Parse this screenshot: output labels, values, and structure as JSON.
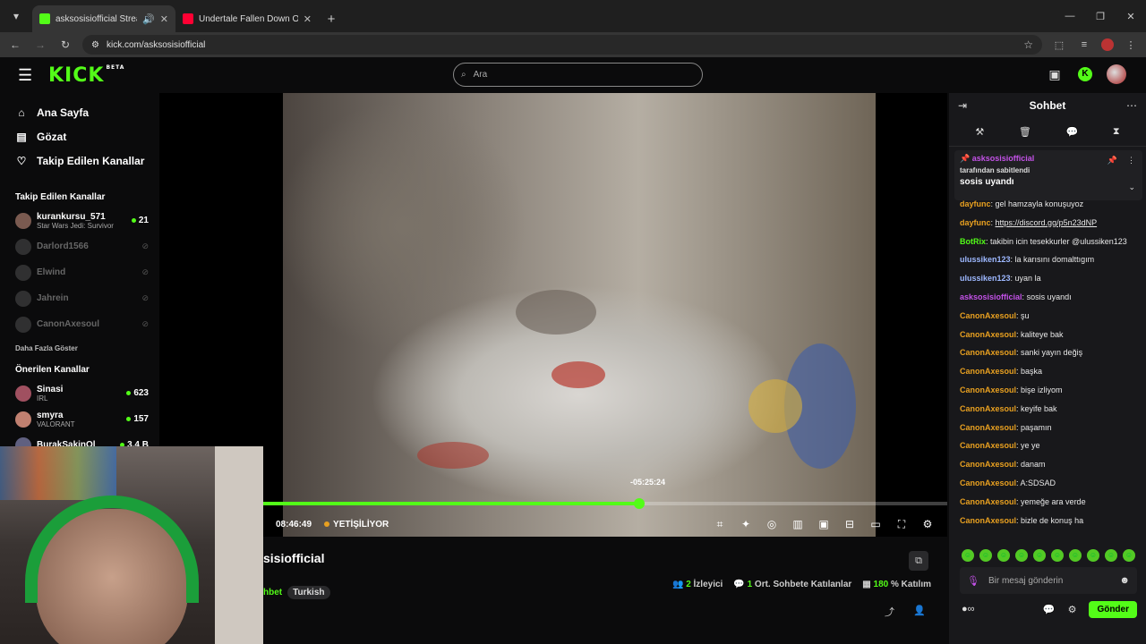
{
  "browser": {
    "tabs": [
      {
        "title": "asksosisiofficial Stream - W",
        "favicon_color": "#53fc18",
        "active": true
      },
      {
        "title": "Undertale Fallen Down OST #",
        "favicon_color": "#ff0033",
        "active": false
      }
    ],
    "url": "kick.com/asksosisiofficial"
  },
  "header": {
    "logo": "KICK",
    "logo_badge": "BETA",
    "search_placeholder": "Ara"
  },
  "sidebar": {
    "nav": [
      {
        "label": "Ana Sayfa",
        "icon": "home-icon"
      },
      {
        "label": "Gözat",
        "icon": "browse-icon"
      },
      {
        "label": "Takip Edilen Kanallar",
        "icon": "heart-icon"
      }
    ],
    "followed_title": "Takip Edilen Kanallar",
    "followed": [
      {
        "name": "kurankursu_571",
        "category": "Star Wars Jedi: Survivor",
        "viewers": "21",
        "live": true
      },
      {
        "name": "Darlord1566",
        "live": false
      },
      {
        "name": "Elwind",
        "live": false
      },
      {
        "name": "Jahrein",
        "live": false
      },
      {
        "name": "CanonAxesoul",
        "live": false
      }
    ],
    "show_more": "Daha Fazla Göster",
    "recommended_title": "Önerilen Kanallar",
    "recommended": [
      {
        "name": "Sinasi",
        "category": "IRL",
        "viewers": "623"
      },
      {
        "name": "smyra",
        "category": "VALORANT",
        "viewers": "157"
      },
      {
        "name": "BurakSakinOl",
        "category": "",
        "viewers": "3.4 B"
      }
    ]
  },
  "player": {
    "elapsed": "08:46:49",
    "live_label": "YETİŞİLİYOR",
    "hover_time": "-05:25:24",
    "progress": 0.55
  },
  "stream": {
    "title_visible": "sisiofficial",
    "category_visible": "hbet",
    "language_tag": "Turkish",
    "viewers_count": "2",
    "viewers_label": "İzleyici",
    "chatters_count": "1",
    "chatters_label": "Ort. Sohbete Katılanlar",
    "participation_count": "180",
    "participation_label": "% Katılım"
  },
  "chat": {
    "title": "Sohbet",
    "pinned": {
      "user": "asksosisiofficial",
      "by": "tarafından sabitlendi",
      "message": "sosis uyandı"
    },
    "messages": [
      {
        "user": "dayfunc",
        "color": "#e8a020",
        "text": "gel hamzayla konuşuyoz"
      },
      {
        "user": "dayfunc",
        "color": "#e8a020",
        "text": "https://discord.gg/p5n23dNP",
        "link": true
      },
      {
        "user": "BotRix",
        "color": "#53fc18",
        "text": "takibin icin tesekkurler @ulussiken123"
      },
      {
        "user": "ulussiken123",
        "color": "#9db8ff",
        "text": "la karısını domalttıgım"
      },
      {
        "user": "ulussiken123",
        "color": "#9db8ff",
        "text": "uyan la"
      },
      {
        "user": "asksosisiofficial",
        "color": "#c452e8",
        "text": "sosis uyandı"
      },
      {
        "user": "CanonAxesoul",
        "color": "#e8a020",
        "text": "şu"
      },
      {
        "user": "CanonAxesoul",
        "color": "#e8a020",
        "text": "kaliteye bak"
      },
      {
        "user": "CanonAxesoul",
        "color": "#e8a020",
        "text": "sanki yayın değiş"
      },
      {
        "user": "CanonAxesoul",
        "color": "#e8a020",
        "text": "başka"
      },
      {
        "user": "CanonAxesoul",
        "color": "#e8a020",
        "text": "bişe izliyom"
      },
      {
        "user": "CanonAxesoul",
        "color": "#e8a020",
        "text": "keyife bak"
      },
      {
        "user": "CanonAxesoul",
        "color": "#e8a020",
        "text": "paşamın"
      },
      {
        "user": "CanonAxesoul",
        "color": "#e8a020",
        "text": "ye ye"
      },
      {
        "user": "CanonAxesoul",
        "color": "#e8a020",
        "text": "danam"
      },
      {
        "user": "CanonAxesoul",
        "color": "#e8a020",
        "text": "A:SDSAD"
      },
      {
        "user": "CanonAxesoul",
        "color": "#e8a020",
        "text": "yemeğe ara verde"
      },
      {
        "user": "CanonAxesoul",
        "color": "#e8a020",
        "text": "bizle de konuş ha"
      }
    ],
    "input_placeholder": "Bir mesaj gönderin",
    "send_label": "Gönder"
  },
  "colors": {
    "accent": "#53fc18",
    "bg": "#0b0b0c",
    "chat_bg": "#18181b"
  }
}
